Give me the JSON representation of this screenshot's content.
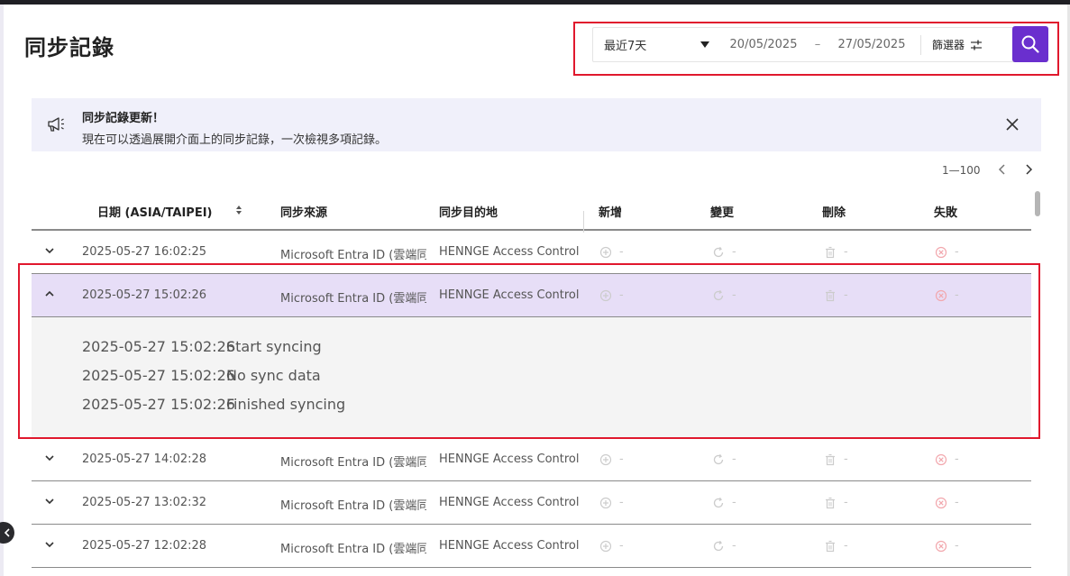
{
  "page": {
    "title": "同步記錄"
  },
  "filter": {
    "range_value": "最近7天",
    "date_from": "20/05/2025",
    "date_sep": "–",
    "date_to": "27/05/2025",
    "filter_label": "篩選器"
  },
  "notice": {
    "title": "同步記錄更新！",
    "text": "現在可以透過展開介面上的同步記錄，一次檢視多項記錄。"
  },
  "pagination": {
    "range": "1—100"
  },
  "table": {
    "headers": {
      "date": "日期 (ASIA/TAIPEI)",
      "source": "同步來源",
      "destination": "同步目的地",
      "add": "新增",
      "change": "變更",
      "delete": "刪除",
      "fail": "失敗"
    },
    "rows": [
      {
        "date": "2025-05-27 16:02:25",
        "source": "Microsoft Entra ID (雲端同",
        "destination": "HENNGE Access Control",
        "add": "-",
        "change": "-",
        "delete": "-",
        "fail": "-"
      },
      {
        "date": "2025-05-27 15:02:26",
        "source": "Microsoft Entra ID (雲端同",
        "destination": "HENNGE Access Control",
        "add": "-",
        "change": "-",
        "delete": "-",
        "fail": "-"
      },
      {
        "date": "2025-05-27 14:02:28",
        "source": "Microsoft Entra ID (雲端同",
        "destination": "HENNGE Access Control",
        "add": "-",
        "change": "-",
        "delete": "-",
        "fail": "-"
      },
      {
        "date": "2025-05-27 13:02:32",
        "source": "Microsoft Entra ID (雲端同",
        "destination": "HENNGE Access Control",
        "add": "-",
        "change": "-",
        "delete": "-",
        "fail": "-"
      },
      {
        "date": "2025-05-27 12:02:28",
        "source": "Microsoft Entra ID (雲端同",
        "destination": "HENNGE Access Control",
        "add": "-",
        "change": "-",
        "delete": "-",
        "fail": "-"
      }
    ],
    "expanded_logs": [
      {
        "time": "2025-05-27 15:02:26",
        "message": "Start syncing"
      },
      {
        "time": "2025-05-27 15:02:26",
        "message": "No sync data"
      },
      {
        "time": "2025-05-27 15:02:26",
        "message": "Finished syncing"
      }
    ]
  },
  "colors": {
    "accent": "#6a2fce",
    "highlight": "#e0182d",
    "expanded_row": "#e7def7",
    "notice_bg": "#f0f0fa",
    "fail_icon": "#f2a7ad"
  },
  "icons": [
    "megaphone-icon",
    "close-icon",
    "search-icon",
    "filter-icon",
    "sort-icon",
    "chevron-left-icon",
    "chevron-right-icon",
    "chevron-down-icon",
    "chevron-up-icon",
    "add-circle-icon",
    "refresh-icon",
    "trash-icon",
    "fail-circle-icon"
  ]
}
